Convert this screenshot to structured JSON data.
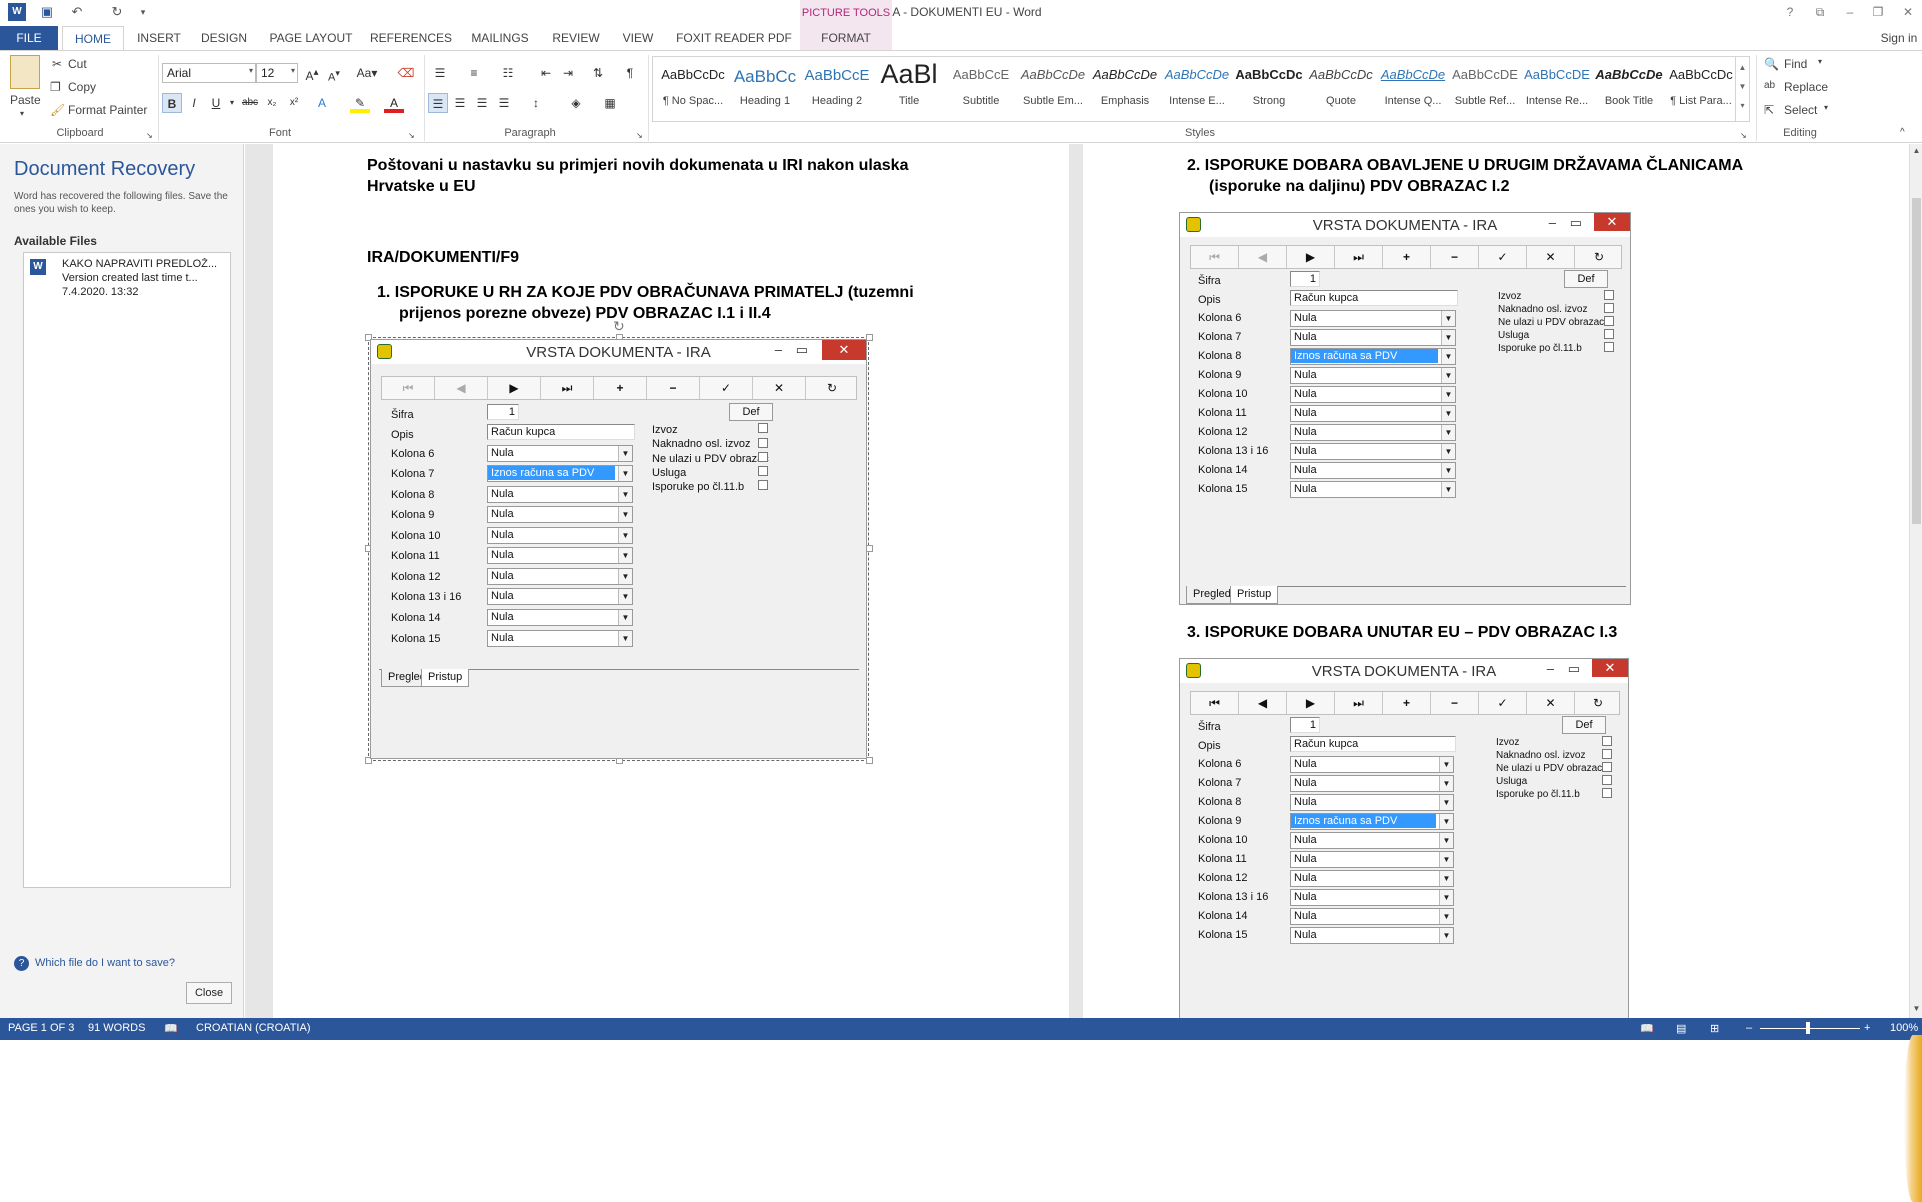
{
  "window": {
    "title": "IRA -  DOKUMENTI EU - Word",
    "picture_tools": "PICTURE TOOLS",
    "help": "?",
    "signin": "Sign in"
  },
  "tabs": [
    "FILE",
    "HOME",
    "INSERT",
    "DESIGN",
    "PAGE LAYOUT",
    "REFERENCES",
    "MAILINGS",
    "REVIEW",
    "VIEW",
    "FOXIT READER PDF",
    "FORMAT"
  ],
  "clipboard": {
    "paste": "Paste",
    "cut": "Cut",
    "copy": "Copy",
    "format_painter": "Format Painter",
    "label": "Clipboard"
  },
  "font": {
    "name": "Arial",
    "size": "12",
    "label": "Font"
  },
  "paragraph": {
    "label": "Paragraph"
  },
  "styles": {
    "label": "Styles",
    "items": [
      {
        "preview": "AaBbCcDc",
        "name": "¶ No Spac..."
      },
      {
        "preview": "AaBbCc",
        "name": "Heading 1"
      },
      {
        "preview": "AaBbCcE",
        "name": "Heading 2"
      },
      {
        "preview": "AaBl",
        "name": "Title"
      },
      {
        "preview": "AaBbCcE",
        "name": "Subtitle"
      },
      {
        "preview": "AaBbCcDe",
        "name": "Subtle Em..."
      },
      {
        "preview": "AaBbCcDe",
        "name": "Emphasis"
      },
      {
        "preview": "AaBbCcDe",
        "name": "Intense E..."
      },
      {
        "preview": "AaBbCcDc",
        "name": "Strong"
      },
      {
        "preview": "AaBbCcDc",
        "name": "Quote"
      },
      {
        "preview": "AaBbCcDe",
        "name": "Intense Q..."
      },
      {
        "preview": "AaBbCcDE",
        "name": "Subtle Ref..."
      },
      {
        "preview": "AaBbCcDE",
        "name": "Intense Re..."
      },
      {
        "preview": "AaBbCcDe",
        "name": "Book Title"
      },
      {
        "preview": "AaBbCcDc",
        "name": "¶ List Para..."
      }
    ]
  },
  "editing": {
    "find": "Find",
    "replace": "Replace",
    "select": "Select",
    "label": "Editing"
  },
  "recovery": {
    "title": "Document Recovery",
    "desc": "Word has recovered the following files. Save the ones you wish to keep.",
    "available": "Available Files",
    "file_name": "KAKO NAPRAVITI PREDLOŽ...",
    "file_note": "Version created last time t...",
    "file_date": "7.4.2020. 13:32",
    "help": "Which file do I want to save?",
    "close": "Close"
  },
  "doc": {
    "intro_line1": "Poštovani u nastavku su primjeri novih dokumenata u IRI nakon ulaska",
    "intro_line2": "Hrvatske u EU",
    "heading": "IRA/DOKUMENTI/F9",
    "item1_line1": "1.   ISPORUKE U RH ZA KOJE PDV OBRAČUNAVA PRIMATELJ (tuzemni",
    "item1_line2": "prijenos porezne obveze) PDV OBRAZAC I.1 i II.4",
    "item2_line1": "2.   ISPORUKE DOBARA OBAVLJENE U DRUGIM DRŽAVAMA ČLANICAMA",
    "item2_line2": "(isporuke na daljinu) PDV OBRAZAC I.2",
    "item3": "3.   ISPORUKE DOBARA UNUTAR EU – PDV OBRAZAC I.3"
  },
  "dialog": {
    "title": "VRSTA DOKUMENTA - IRA",
    "toolbar": [
      "⏮",
      "◀",
      "▶",
      "⏭",
      "+",
      "−",
      "✓",
      "✕",
      "↻"
    ],
    "sifra_label": "Šifra",
    "sifra_value": "1",
    "def": "Def",
    "opis_label": "Opis",
    "opis_value": "Račun kupca",
    "rows": [
      "Kolona 6",
      "Kolona 7",
      "Kolona 8",
      "Kolona 9",
      "Kolona 10",
      "Kolona 11",
      "Kolona 12",
      "Kolona 13 i 16",
      "Kolona 14",
      "Kolona 15"
    ],
    "nula": "Nula",
    "highlight": "Iznos računa sa PDV",
    "checks": [
      "Izvoz",
      "Naknadno osl. izvoz",
      "Ne ulazi u PDV obrazac",
      "Usluga",
      "Isporuke po čl.11.b"
    ],
    "tab_pregled": "Pregled",
    "tab_pristup": "Pristup"
  },
  "status": {
    "page": "PAGE 1 OF 3",
    "words": "91 WORDS",
    "language": "CROATIAN (CROATIA)",
    "zoom": "100%"
  }
}
